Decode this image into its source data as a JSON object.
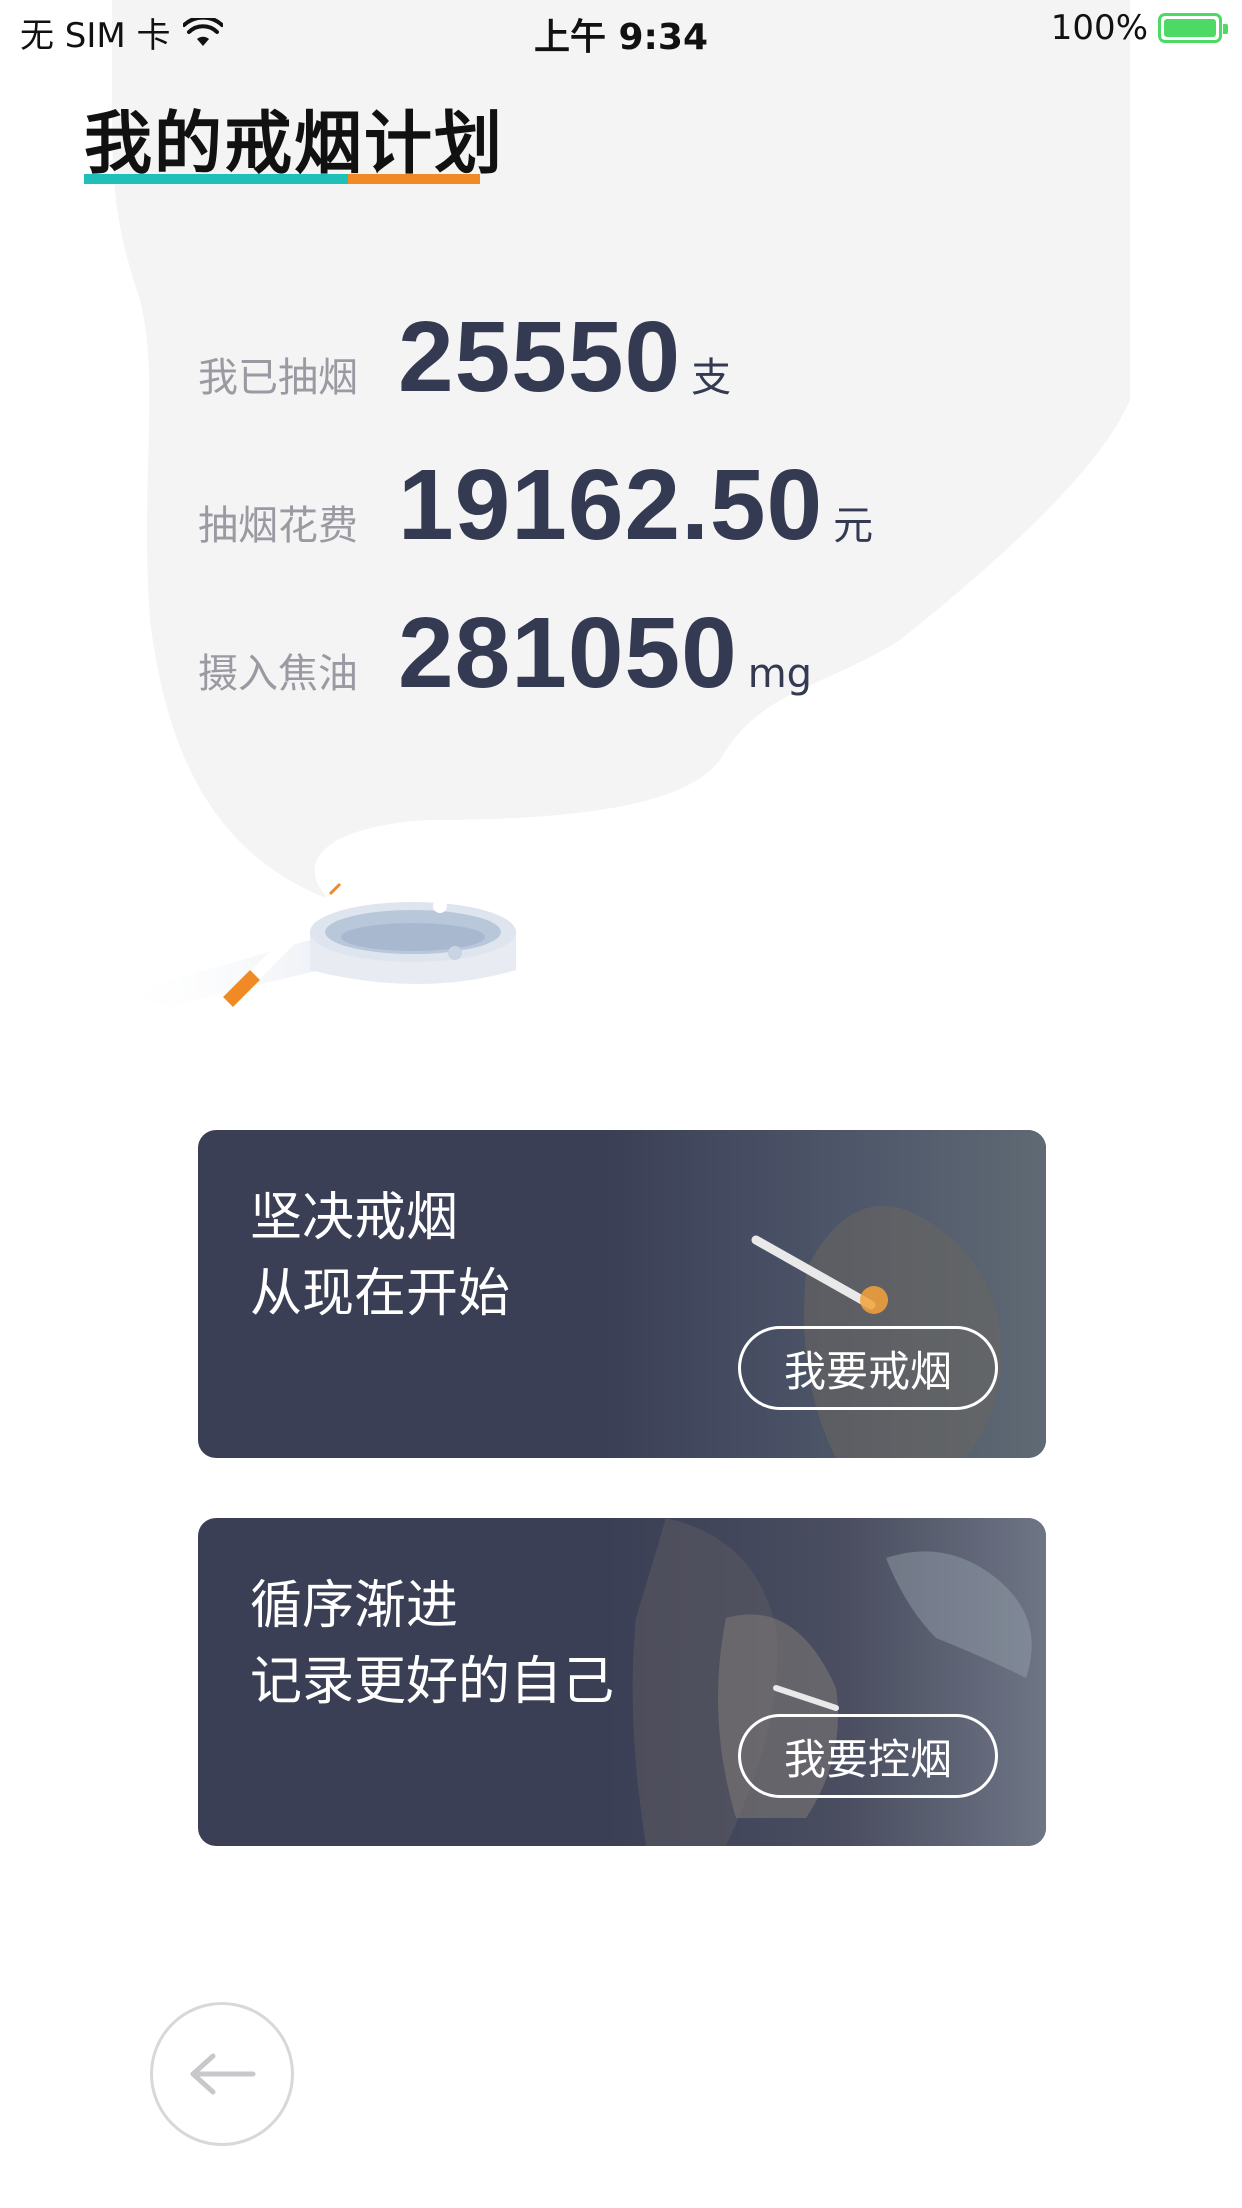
{
  "status_bar": {
    "carrier": "无 SIM 卡",
    "time": "上午 9:34",
    "battery": "100%"
  },
  "header": {
    "title": "我的戒烟计划",
    "underline_colors": [
      "#20c0b8",
      "#f08a24"
    ]
  },
  "stats": [
    {
      "label": "我已抽烟",
      "value": "25550",
      "unit": "支"
    },
    {
      "label": "抽烟花费",
      "value": "19162.50",
      "unit": "元"
    },
    {
      "label": "摄入焦油",
      "value": "281050",
      "unit": "mg"
    }
  ],
  "cards": [
    {
      "line1": "坚决戒烟",
      "line2": "从现在开始",
      "button": "我要戒烟"
    },
    {
      "line1": "循序渐进",
      "line2": "记录更好的自己",
      "button": "我要控烟"
    }
  ],
  "icons": {
    "wifi": "wifi-icon",
    "battery": "battery-charging-icon",
    "ashtray": "ashtray-cigarette-illustration",
    "back": "arrow-left-icon"
  },
  "colors": {
    "card_bg": "#3b3f55",
    "stat_value": "#343a52",
    "stat_label": "#9a9aa2",
    "accent_teal": "#20c0b8",
    "accent_orange": "#f08a24"
  }
}
